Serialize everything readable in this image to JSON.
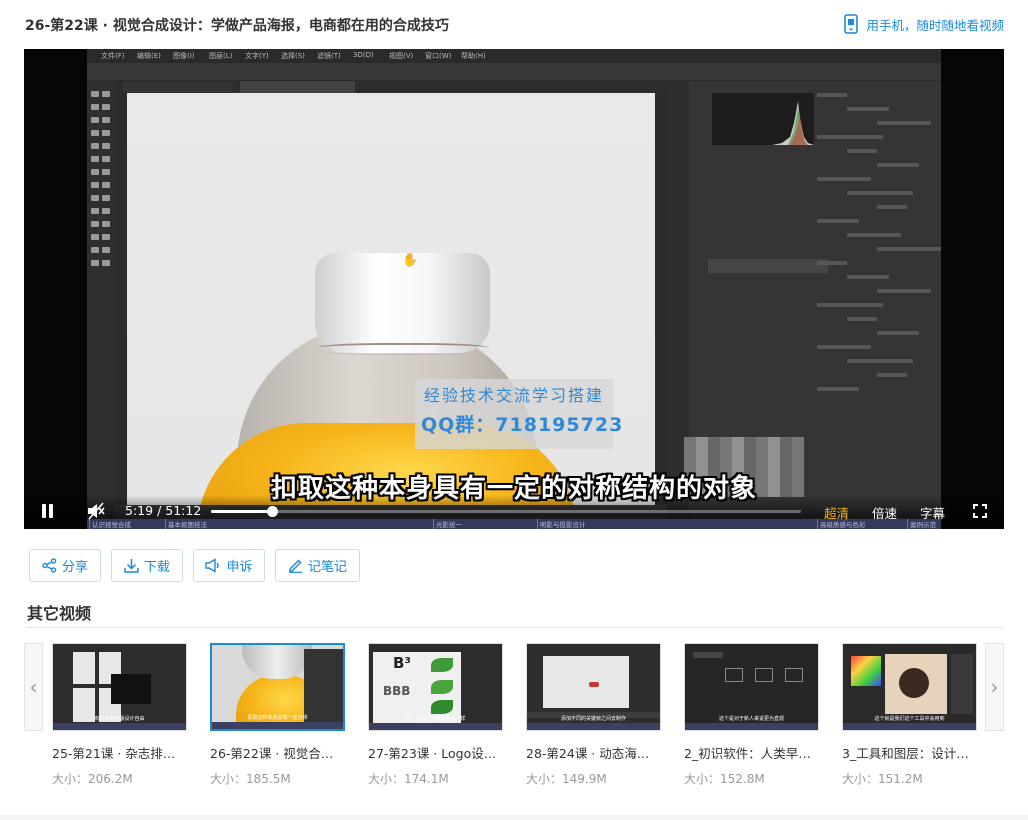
{
  "header": {
    "title": "26-第22课 · 视觉合成设计：学做产品海报，电商都在用的合成技巧",
    "mobile_link": "用手机，随时随地看视频"
  },
  "player": {
    "watermark_line1": "经验技术交流学习搭建",
    "watermark_line2": "QQ群：718195723",
    "subtitle": "扣取这种本身具有一定的对称结构的对象",
    "current_time": "5:19",
    "time_separator": "/",
    "duration": "51:12",
    "progress_fraction": 0.104,
    "quality_label": "超清",
    "speed_label": "倍速",
    "caption_label": "字幕",
    "chapter_labels": [
      "认识视觉合成",
      "基本抠图技法",
      "光影统一",
      "明影与投影设计",
      "高级质感与色彩",
      "案例示范"
    ],
    "ps_menu": [
      "文件(F)",
      "编辑(E)",
      "图像(I)",
      "图层(L)",
      "文字(Y)",
      "选择(S)",
      "滤镜(T)",
      "3D(D)",
      "视图(V)",
      "窗口(W)",
      "帮助(H)"
    ]
  },
  "actions": [
    {
      "label": "分享",
      "icon": "share-icon"
    },
    {
      "label": "下载",
      "icon": "download-icon"
    },
    {
      "label": "申诉",
      "icon": "megaphone-icon"
    },
    {
      "label": "记笔记",
      "icon": "pencil-icon"
    }
  ],
  "other_videos": {
    "title": "其它视频",
    "items": [
      {
        "title": "25-第21课 · 杂志排版...",
        "size": "大小：206.2M",
        "caption": "有文字把排版设计自由"
      },
      {
        "title": "26-第22课 · 视觉合成...",
        "size": "大小：185.5M",
        "caption": "抠取这种本身具有一定对称"
      },
      {
        "title": "27-第23课 · Logo设计...",
        "size": "大小：174.1M",
        "caption": "统一它的设计风格并且一样"
      },
      {
        "title": "28-第24课 · 动态海报...",
        "size": "大小：149.9M",
        "caption": "添加不同的关键帧之间去制作"
      },
      {
        "title": "2_初识软件：人类早期...",
        "size": "大小：152.8M",
        "caption": "这个是对于新人来说更为直观"
      },
      {
        "title": "3_工具和图层：设计是...",
        "size": "大小：151.2M",
        "caption": "这个就是我们这个工具中会用到"
      }
    ]
  },
  "colors": {
    "accent": "#1a8ad9",
    "quality_active": "#f5b41a",
    "watermark": "#2f88d8"
  }
}
